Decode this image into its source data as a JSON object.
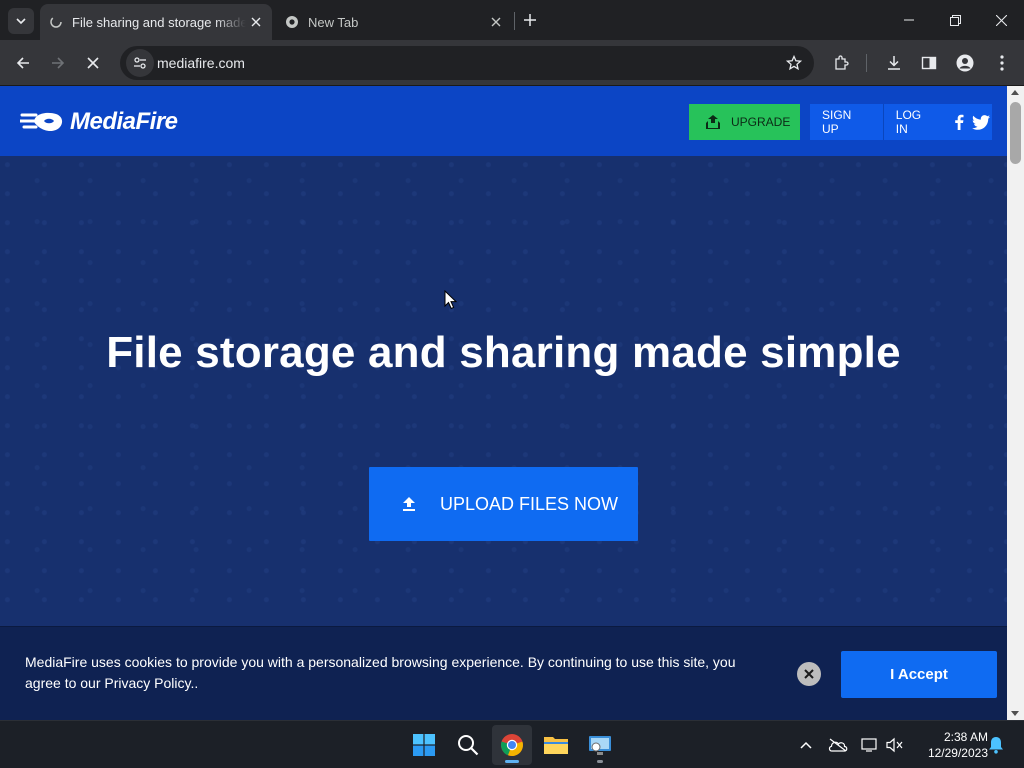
{
  "browser": {
    "tabs": [
      {
        "title": "File sharing and storage made simple",
        "active": true
      },
      {
        "title": "New Tab",
        "active": false
      }
    ],
    "address": "mediafire.com"
  },
  "site": {
    "logo_text": "MediaFire",
    "upgrade_label": "UPGRADE",
    "signup_label": "SIGN UP",
    "login_label": "LOG IN",
    "hero_title": "File storage and sharing made simple",
    "upload_label": "UPLOAD FILES NOW",
    "cookie_message": "MediaFire uses cookies to provide you with a personalized browsing experience. By continuing to use this site, you agree to our Privacy Policy..",
    "accept_label": "I Accept"
  },
  "taskbar": {
    "time": "2:38 AM",
    "date": "12/29/2023"
  },
  "colors": {
    "header_blue": "#0c45c5",
    "hero_navy": "#17306e",
    "upgrade_green": "#27c25a",
    "cta_blue": "#0f6bf2"
  }
}
